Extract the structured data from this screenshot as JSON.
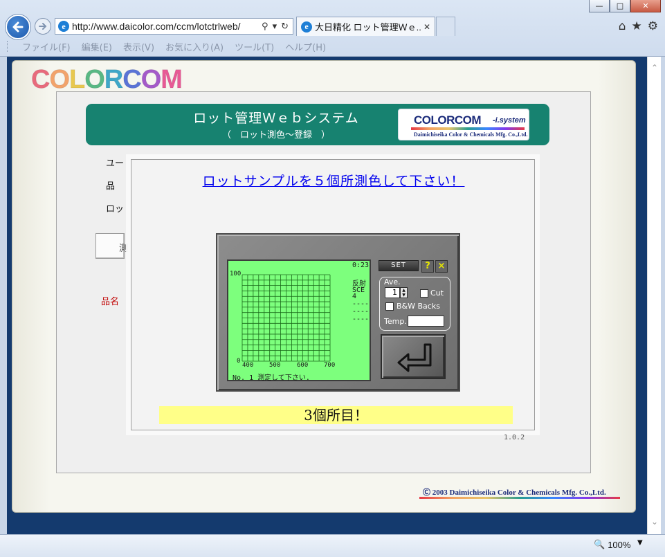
{
  "browser": {
    "address_url": "http://www.daicolor.com/ccm/lotctrlweb/",
    "tab_title": "大日精化 ロット管理Ｗｅ...",
    "menu": [
      "ファイル(F)",
      "編集(E)",
      "表示(V)",
      "お気に入り(A)",
      "ツール(T)",
      "ヘルプ(H)"
    ],
    "zoom_level": "100%"
  },
  "page": {
    "logo_letters": [
      "C",
      "O",
      "L",
      "O",
      "R",
      "C",
      "O",
      "M"
    ],
    "logo_colors": [
      "#e86a7c",
      "#f2a36b",
      "#e8c84f",
      "#59b884",
      "#3fa7c8",
      "#5a73d6",
      "#a45ac9",
      "#e85a96"
    ],
    "banner": {
      "title": "ロット管理Ｗｅｂシステム",
      "subtitle": "（　ロット測色～登録　）",
      "logo_main": "COLORCOM",
      "logo_suffix": "-i.system",
      "logo_company": "Daimichiseika Color & Chemicals Mfg. Co.,Ltd."
    },
    "form_labels": {
      "user": "ユー",
      "product": "品",
      "lot": "ロッ",
      "side_button": "測",
      "product_name": "品名"
    },
    "copyright": "Ⓒ 2003 Daimichiseika Color & Chemicals Mfg. Co.,Ltd."
  },
  "dialog": {
    "heading": "ロットサンプルを５個所測色して下さい！",
    "progress_text": "3個所目！",
    "version": "1.0.2"
  },
  "instrument": {
    "timer": "0:23",
    "mode_lines": [
      "反射",
      "SCE",
      "4",
      "----",
      "----",
      "----"
    ],
    "y_top_label": "100",
    "y_bottom_label": "0",
    "x_ticks": [
      "400",
      "500",
      "600",
      "700"
    ],
    "status_message": "No. 1 測定して下さい.",
    "set_label": "SET",
    "help_label": "?",
    "close_label": "×",
    "ave_label": "Ave.",
    "ave_value": "1",
    "cut_label": "Cut",
    "bw_label": "B&W Backs",
    "temp_label": "Temp.",
    "screen_color": "#7dff7d",
    "grid_color": "#1a6a1a"
  }
}
